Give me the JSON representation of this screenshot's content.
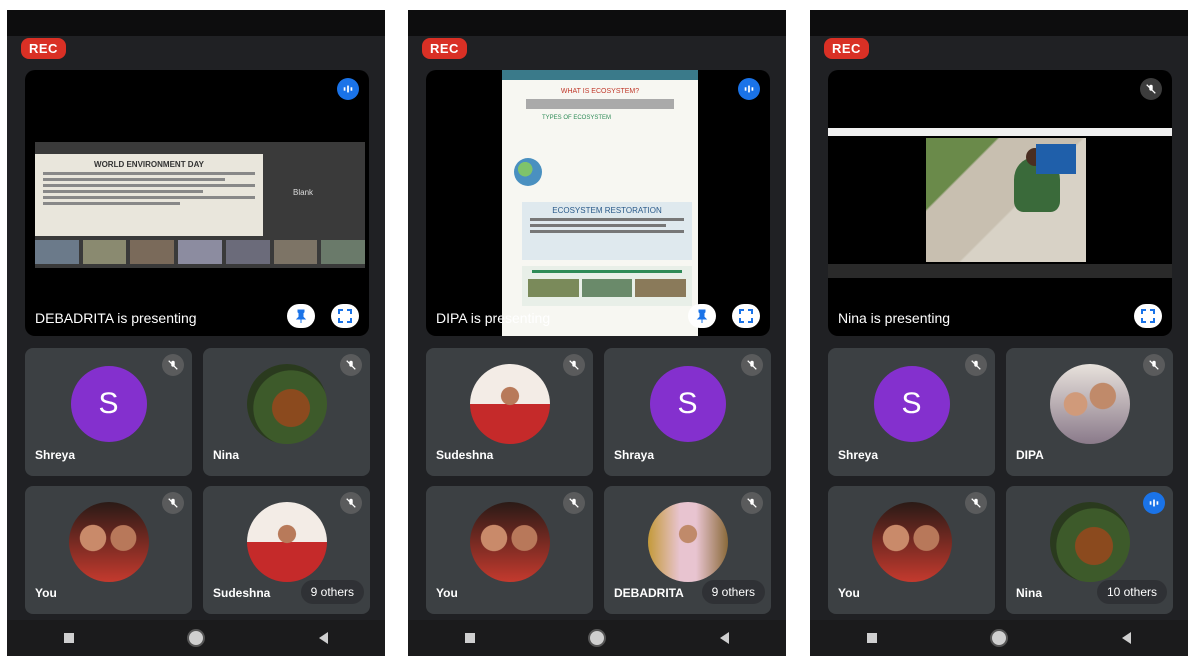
{
  "screens": [
    {
      "rec": "REC",
      "presenter_label": "DEBADRITA is presenting",
      "slide": {
        "title": "WORLD ENVIRONMENT DAY",
        "side_label": "Blank"
      },
      "tiles": [
        {
          "name": "Shreya",
          "avatar_letter": "S"
        },
        {
          "name": "Nina"
        },
        {
          "name": "You"
        },
        {
          "name": "Sudeshna"
        }
      ],
      "others": "9 others"
    },
    {
      "rec": "REC",
      "presenter_label": "DIPA is presenting",
      "slide": {
        "title": "WHAT IS ECOSYSTEM?",
        "subtitle": "TYPES OF ECOSYSTEM",
        "title2": "ECOSYSTEM RESTORATION"
      },
      "tiles": [
        {
          "name": "Sudeshna"
        },
        {
          "name": "Shraya",
          "avatar_letter": "S"
        },
        {
          "name": "You"
        },
        {
          "name": "DEBADRITA"
        }
      ],
      "others": "9 others"
    },
    {
      "rec": "REC",
      "presenter_label": "Nina is presenting",
      "tiles": [
        {
          "name": "Shreya",
          "avatar_letter": "S"
        },
        {
          "name": "DIPA"
        },
        {
          "name": "You"
        },
        {
          "name": "Nina"
        }
      ],
      "others": "10 others"
    }
  ],
  "colors": {
    "rec": "#d93025",
    "accent": "#1a73e8",
    "avatar": "#8430ce",
    "tile": "#3c4043"
  },
  "icons": [
    "mic-off-icon",
    "speaking-icon",
    "pin-icon",
    "fullscreen-icon",
    "home-icon",
    "back-icon",
    "recents-icon"
  ]
}
